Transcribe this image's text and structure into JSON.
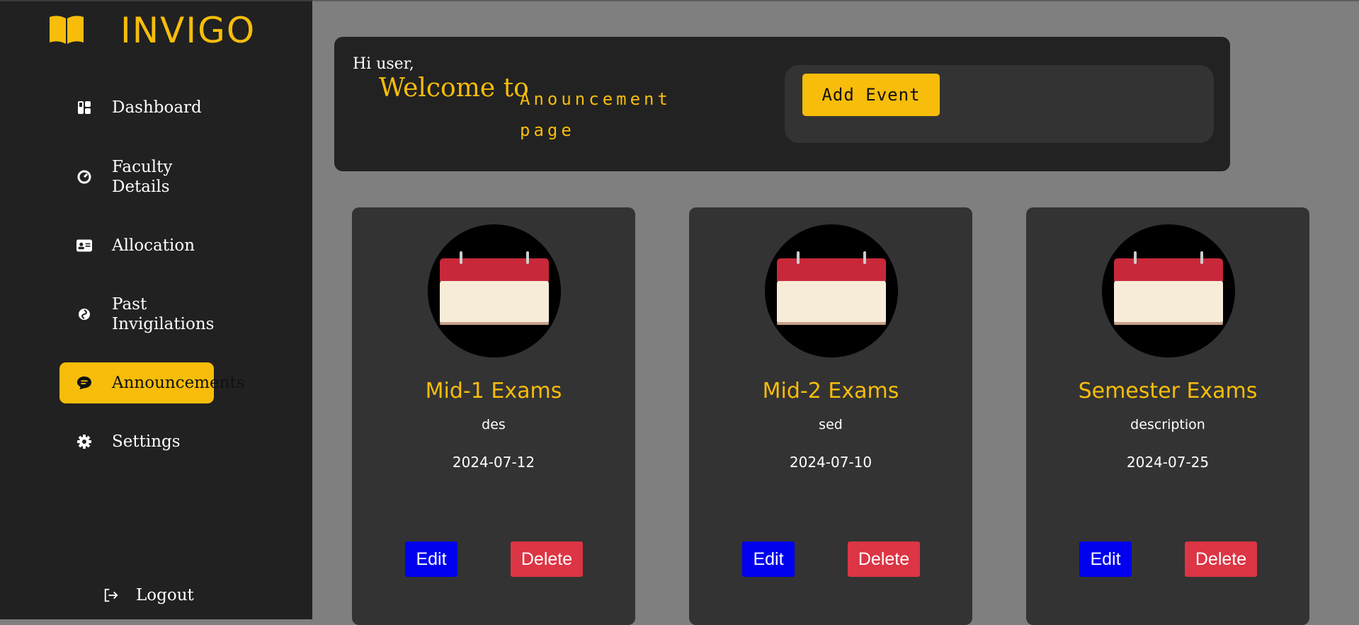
{
  "app": {
    "name": "INVIGO"
  },
  "colors": {
    "accent": "#f7bd0a",
    "sidebar": "#212121",
    "card": "#333333",
    "edit": "#0000ee",
    "delete": "#dc3545"
  },
  "sidebar": {
    "items": [
      {
        "label": "Dashboard",
        "icon": "dashboard-icon"
      },
      {
        "label": "Faculty Details",
        "icon": "gauge-icon"
      },
      {
        "label": "Allocation",
        "icon": "id-card-icon"
      },
      {
        "label": "Past Invigilations",
        "icon": "swirl-icon"
      },
      {
        "label": "Announcements",
        "icon": "chat-icon",
        "active": true
      },
      {
        "label": "Settings",
        "icon": "gear-icon"
      }
    ],
    "logout_label": "Logout"
  },
  "header": {
    "greeting": "Hi user,",
    "welcome": "Welcome to",
    "page_name": "Anouncement page",
    "add_event_label": "Add Event"
  },
  "cards": [
    {
      "title": "Mid-1 Exams",
      "description": "des",
      "date": "2024-07-12",
      "edit_label": "Edit",
      "delete_label": "Delete"
    },
    {
      "title": "Mid-2 Exams",
      "description": "sed",
      "date": "2024-07-10",
      "edit_label": "Edit",
      "delete_label": "Delete"
    },
    {
      "title": "Semester Exams",
      "description": "description",
      "date": "2024-07-25",
      "edit_label": "Edit",
      "delete_label": "Delete"
    }
  ]
}
